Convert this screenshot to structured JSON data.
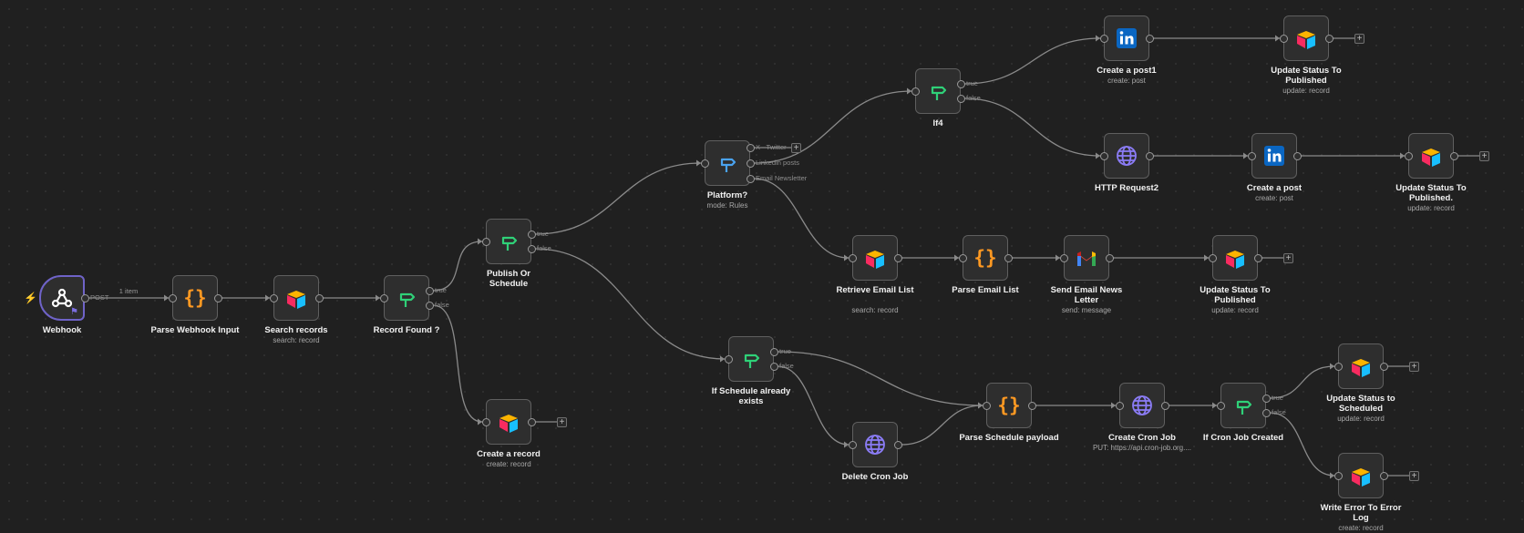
{
  "canvas": {
    "background": "#202020",
    "edge_color": "#8a8a8a"
  },
  "colors": {
    "airtable_yellow": "#fcb400",
    "airtable_blue": "#18bfff",
    "airtable_red": "#f82b60",
    "if_green": "#2fd178",
    "switch_blue": "#4aa3f0",
    "code_orange": "#ff9922",
    "http_purple": "#8b7cf6",
    "linkedin": "#0a66c2"
  },
  "nodes": [
    {
      "id": "webhook",
      "type": "webhook",
      "label": "Webhook",
      "icon": "webhook-icon"
    },
    {
      "id": "parse_webhook",
      "type": "code",
      "label": "Parse Webhook Input",
      "icon": "code-braces-icon"
    },
    {
      "id": "search_records",
      "type": "airtable",
      "label": "Search records",
      "sub": "search: record",
      "icon": "airtable-icon"
    },
    {
      "id": "record_found",
      "type": "if",
      "label": "Record Found ?",
      "icon": "if-branch-icon"
    },
    {
      "id": "publish_or_schedule",
      "type": "if",
      "label": "Publish Or Schedule",
      "icon": "if-branch-icon"
    },
    {
      "id": "create_record",
      "type": "airtable",
      "label": "Create a record",
      "sub": "create: record",
      "icon": "airtable-icon"
    },
    {
      "id": "platform",
      "type": "switch",
      "label": "Platform?",
      "sub": "mode: Rules",
      "icon": "switch-icon"
    },
    {
      "id": "if4",
      "type": "if",
      "label": "If4",
      "icon": "if-branch-icon"
    },
    {
      "id": "create_post1",
      "type": "linkedin",
      "label": "Create a post1",
      "sub": "create: post",
      "icon": "linkedin-icon"
    },
    {
      "id": "update_published1",
      "type": "airtable",
      "label": "Update Status To Published",
      "sub": "update: record",
      "icon": "airtable-icon"
    },
    {
      "id": "http_request2",
      "type": "http",
      "label": "HTTP Request2",
      "icon": "globe-icon"
    },
    {
      "id": "create_post",
      "type": "linkedin",
      "label": "Create a post",
      "sub": "create: post",
      "icon": "linkedin-icon"
    },
    {
      "id": "update_published2",
      "type": "airtable",
      "label": "Update Status To Published.",
      "sub": "update: record",
      "icon": "airtable-icon"
    },
    {
      "id": "retrieve_email",
      "type": "airtable",
      "label": "Retrieve Email List",
      "sub": "search: record",
      "icon": "airtable-icon"
    },
    {
      "id": "parse_email",
      "type": "code",
      "label": "Parse Email List",
      "icon": "code-braces-icon"
    },
    {
      "id": "send_newsletter",
      "type": "gmail",
      "label": "Send Email News Letter",
      "sub": "send: message",
      "icon": "gmail-icon"
    },
    {
      "id": "update_published3",
      "type": "airtable",
      "label": "Update Status To Published",
      "sub": "update: record",
      "icon": "airtable-icon"
    },
    {
      "id": "if_schedule",
      "type": "if",
      "label": "If Schedule already exists",
      "icon": "if-branch-icon"
    },
    {
      "id": "delete_cron",
      "type": "http",
      "label": "Delete Cron Job",
      "icon": "globe-icon"
    },
    {
      "id": "parse_schedule",
      "type": "code",
      "label": "Parse Schedule payload",
      "icon": "code-braces-icon"
    },
    {
      "id": "create_cron",
      "type": "http",
      "label": "Create Cron Job",
      "sub": "PUT: https://api.cron-job.org....",
      "icon": "globe-icon"
    },
    {
      "id": "if_cron_created",
      "type": "if",
      "label": "If Cron Job Created",
      "icon": "if-branch-icon"
    },
    {
      "id": "update_scheduled",
      "type": "airtable",
      "label": "Update Status to Scheduled",
      "sub": "update: record",
      "icon": "airtable-icon"
    },
    {
      "id": "write_error",
      "type": "airtable",
      "label": "Write Error To Error Log",
      "sub": "create: record",
      "icon": "airtable-icon"
    }
  ],
  "edges": [
    {
      "from": "webhook",
      "to": "parse_webhook",
      "out": 0,
      "out_label": "POST",
      "edge_label": "1 item"
    },
    {
      "from": "parse_webhook",
      "to": "search_records",
      "out": 0
    },
    {
      "from": "search_records",
      "to": "record_found",
      "out": 0
    },
    {
      "from": "record_found",
      "to": "publish_or_schedule",
      "out": 0
    },
    {
      "from": "record_found",
      "to": "create_record",
      "out": 1
    },
    {
      "from": "publish_or_schedule",
      "to": "platform",
      "out": 0
    },
    {
      "from": "publish_or_schedule",
      "to": "if_schedule",
      "out": 1
    },
    {
      "from": "platform",
      "to": "if4",
      "out": 1
    },
    {
      "from": "platform",
      "to": "retrieve_email",
      "out": 2
    },
    {
      "from": "if4",
      "to": "create_post1",
      "out": 0
    },
    {
      "from": "if4",
      "to": "http_request2",
      "out": 1
    },
    {
      "from": "create_post1",
      "to": "update_published1",
      "out": 0
    },
    {
      "from": "http_request2",
      "to": "create_post",
      "out": 0
    },
    {
      "from": "create_post",
      "to": "update_published2",
      "out": 0
    },
    {
      "from": "retrieve_email",
      "to": "parse_email",
      "out": 0
    },
    {
      "from": "parse_email",
      "to": "send_newsletter",
      "out": 0
    },
    {
      "from": "send_newsletter",
      "to": "update_published3",
      "out": 0
    },
    {
      "from": "if_schedule",
      "to": "parse_schedule",
      "out": 0
    },
    {
      "from": "if_schedule",
      "to": "delete_cron",
      "out": 1
    },
    {
      "from": "delete_cron",
      "to": "parse_schedule",
      "out": 0
    },
    {
      "from": "parse_schedule",
      "to": "create_cron",
      "out": 0
    },
    {
      "from": "create_cron",
      "to": "if_cron_created",
      "out": 0
    },
    {
      "from": "if_cron_created",
      "to": "update_scheduled",
      "out": 0
    },
    {
      "from": "if_cron_created",
      "to": "write_error",
      "out": 1
    }
  ],
  "branch_labels": {
    "if": [
      "true",
      "false"
    ],
    "platform": [
      "X - Twitter",
      "Linkedin posts",
      "Email Newsletter"
    ]
  },
  "dangling_plus": [
    "platform:0",
    "update_published1",
    "update_published2",
    "update_published3",
    "create_record",
    "update_scheduled",
    "write_error"
  ],
  "plus_symbol": "+"
}
